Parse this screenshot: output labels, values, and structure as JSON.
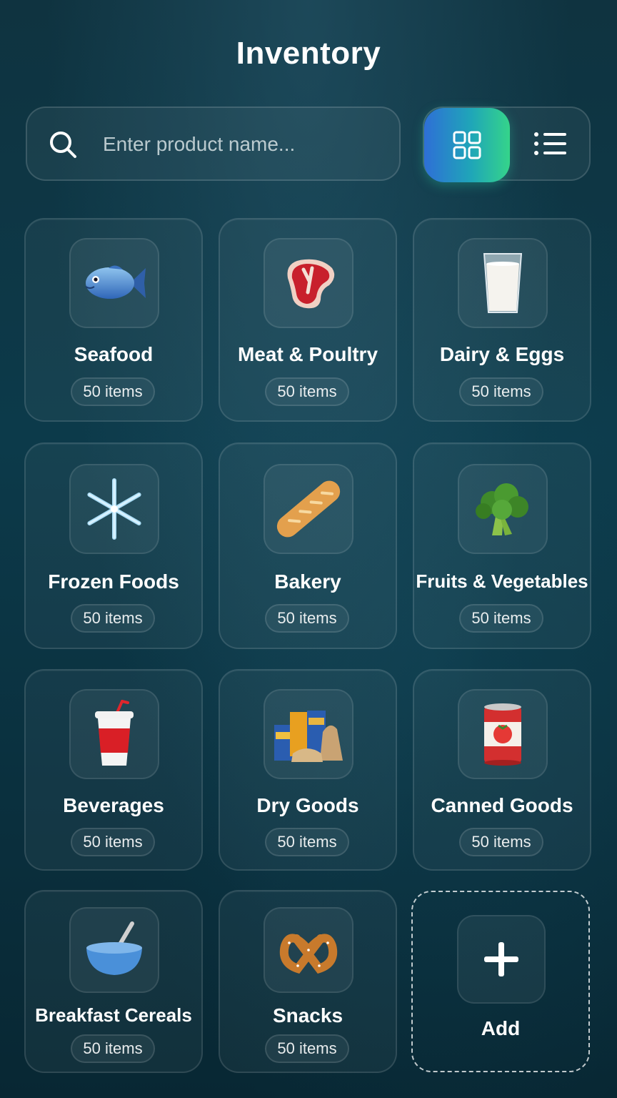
{
  "header": {
    "title": "Inventory"
  },
  "search": {
    "placeholder": "Enter product name..."
  },
  "view_toggle": {
    "active": "grid",
    "grid_icon": "grid-view-icon",
    "list_icon": "list-view-icon"
  },
  "categories": [
    {
      "name": "Seafood",
      "count": "50 items",
      "icon": "fish-icon"
    },
    {
      "name": "Meat & Poultry",
      "count": "50 items",
      "icon": "meat-icon"
    },
    {
      "name": "Dairy & Eggs",
      "count": "50 items",
      "icon": "milk-icon"
    },
    {
      "name": "Frozen Foods",
      "count": "50 items",
      "icon": "snowflake-icon"
    },
    {
      "name": "Bakery",
      "count": "50 items",
      "icon": "bread-icon"
    },
    {
      "name": "Fruits & Vegetables",
      "count": "50 items",
      "icon": "broccoli-icon"
    },
    {
      "name": "Beverages",
      "count": "50 items",
      "icon": "drink-cup-icon"
    },
    {
      "name": "Dry Goods",
      "count": "50 items",
      "icon": "dry-goods-icon"
    },
    {
      "name": "Canned Goods",
      "count": "50 items",
      "icon": "tomato-can-icon"
    },
    {
      "name": "Breakfast Cereals",
      "count": "50 items",
      "icon": "cereal-bowl-icon"
    },
    {
      "name": "Snacks",
      "count": "50 items",
      "icon": "pretzel-icon"
    }
  ],
  "add_card": {
    "label": "Add",
    "icon": "plus-icon"
  },
  "colors": {
    "accent_start": "#2e6fd6",
    "accent_end": "#35d48a",
    "background": "#0c3a4a"
  }
}
